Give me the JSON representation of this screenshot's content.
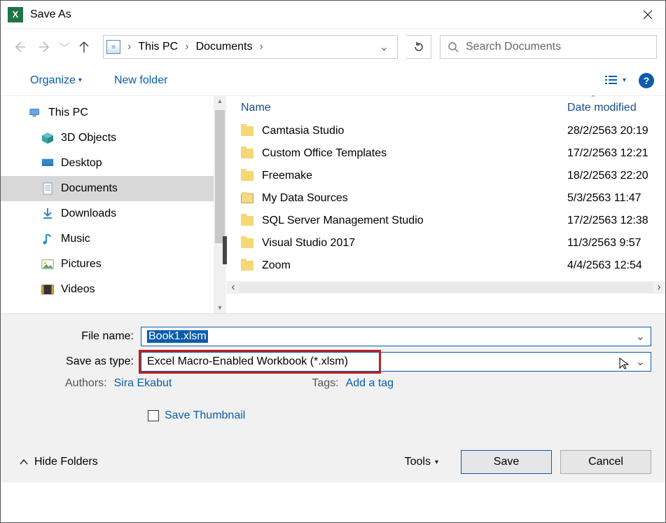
{
  "title": "Save As",
  "breadcrumb": {
    "pc": "This PC",
    "docs": "Documents"
  },
  "search_placeholder": "Search Documents",
  "toolbar": {
    "organize": "Organize",
    "newfolder": "New folder"
  },
  "tree": {
    "thispc": "This PC",
    "objects3d": "3D Objects",
    "desktop": "Desktop",
    "documents": "Documents",
    "downloads": "Downloads",
    "music": "Music",
    "pictures": "Pictures",
    "videos": "Videos"
  },
  "columns": {
    "name": "Name",
    "date": "Date modified"
  },
  "files": [
    {
      "name": "Camtasia Studio",
      "date": "28/2/2563 20:19",
      "special": false
    },
    {
      "name": "Custom Office Templates",
      "date": "17/2/2563 12:21",
      "special": false
    },
    {
      "name": "Freemake",
      "date": "18/2/2563 22:20",
      "special": false
    },
    {
      "name": "My Data Sources",
      "date": "5/3/2563 11:47",
      "special": true
    },
    {
      "name": "SQL Server Management Studio",
      "date": "17/2/2563 12:38",
      "special": false
    },
    {
      "name": "Visual Studio 2017",
      "date": "11/3/2563 9:57",
      "special": false
    },
    {
      "name": "Zoom",
      "date": "4/4/2563 12:54",
      "special": false
    }
  ],
  "form": {
    "filename_label": "File name:",
    "filename_value": "Book1.xlsm",
    "type_label": "Save as type:",
    "type_value": "Excel Macro-Enabled Workbook (*.xlsm)",
    "authors_label": "Authors:",
    "authors_value": "Sira Ekabut",
    "tags_label": "Tags:",
    "tags_value": "Add a tag",
    "save_thumb": "Save Thumbnail"
  },
  "footer": {
    "hide": "Hide Folders",
    "tools": "Tools",
    "save": "Save",
    "cancel": "Cancel"
  }
}
